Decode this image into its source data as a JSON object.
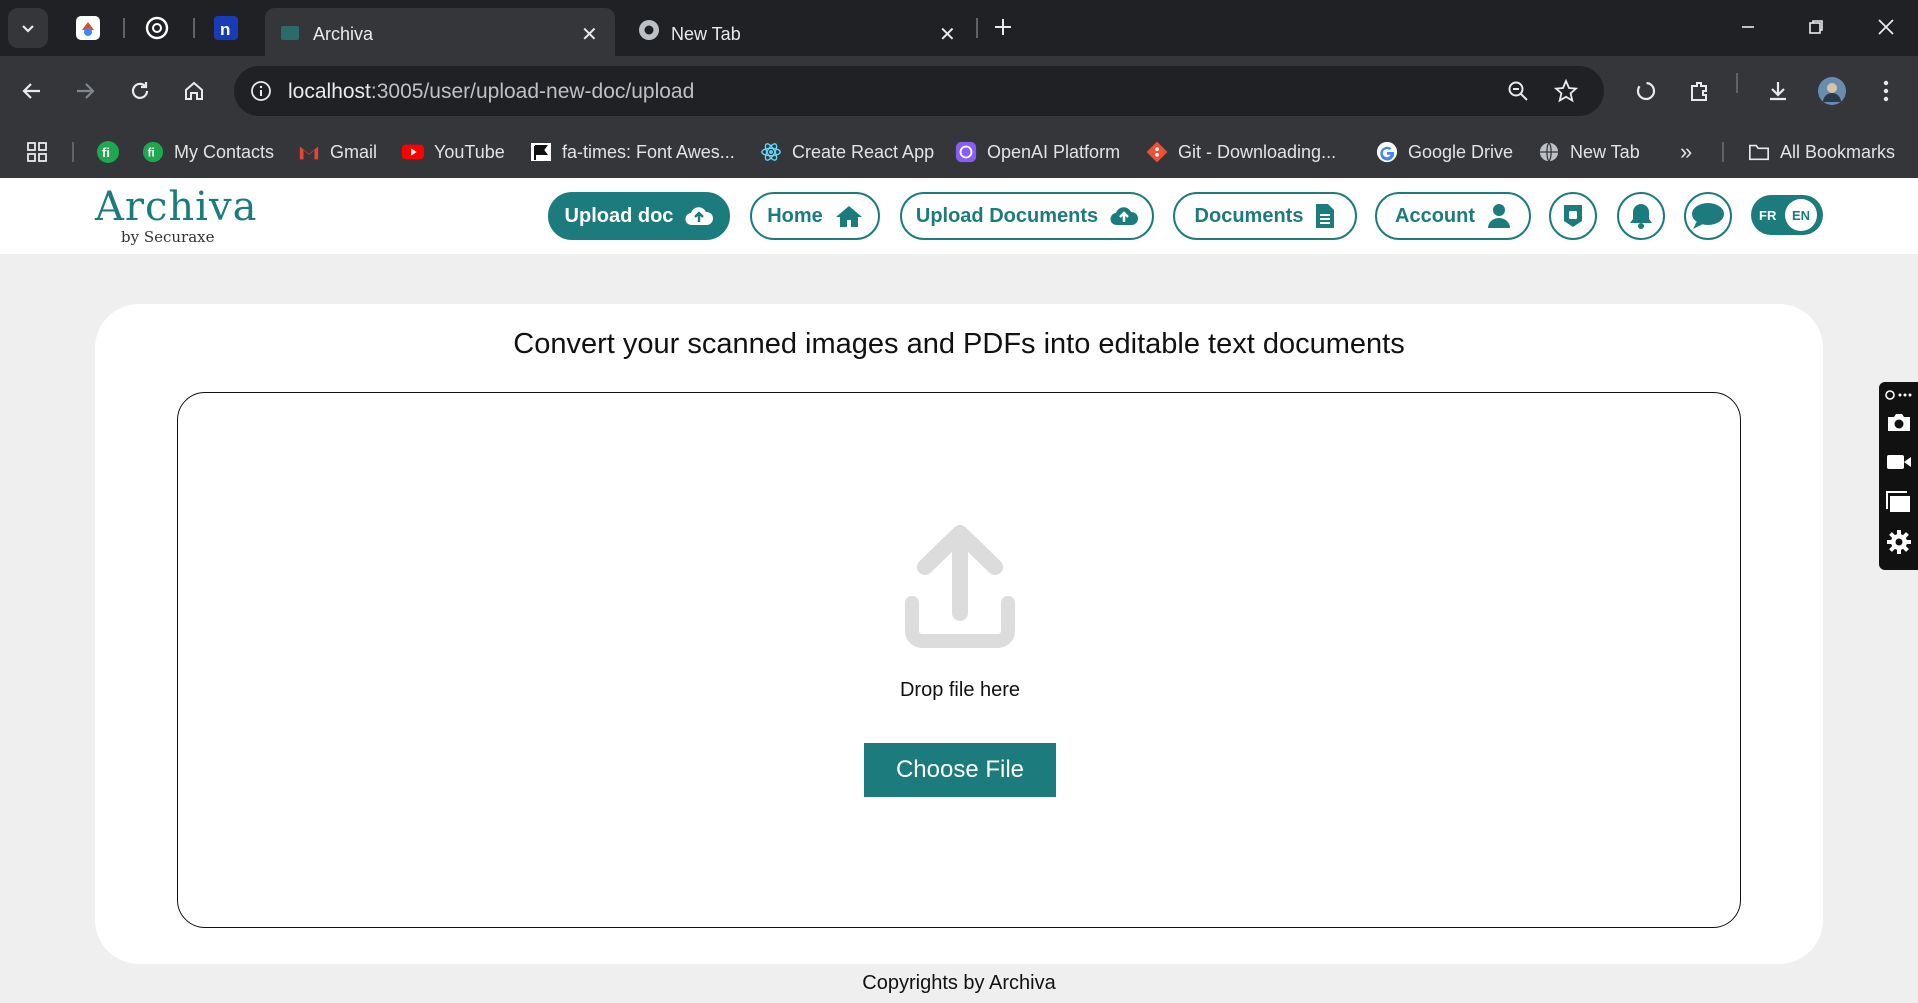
{
  "browser": {
    "tabs": [
      {
        "title": "Archiva",
        "active": true
      },
      {
        "title": "New Tab",
        "active": false
      }
    ],
    "address": {
      "host": "localhost",
      "path": ":3005/user/upload-new-doc/upload"
    },
    "bookmarks": [
      {
        "label": "My Contacts",
        "icon": "contacts-icon"
      },
      {
        "label": "Gmail",
        "icon": "gmail-icon"
      },
      {
        "label": "YouTube",
        "icon": "youtube-icon"
      },
      {
        "label": "fa-times: Font Awes...",
        "icon": "flag-icon"
      },
      {
        "label": "Create React App",
        "icon": "react-icon"
      },
      {
        "label": "OpenAI Platform",
        "icon": "openai-icon"
      },
      {
        "label": "Git - Downloading...",
        "icon": "git-icon"
      },
      {
        "label": "Google Drive",
        "icon": "google-icon"
      },
      {
        "label": "New Tab",
        "icon": "globe-icon"
      }
    ],
    "overflow": "»",
    "all_bookmarks": "All Bookmarks"
  },
  "app": {
    "logo": {
      "name": "Archiva",
      "tagline": "by Securaxe"
    },
    "nav": {
      "upload_doc": "Upload doc",
      "home": "Home",
      "upload_documents": "Upload Documents",
      "documents": "Documents",
      "account": "Account"
    },
    "lang": {
      "fr": "FR",
      "en": "EN"
    },
    "accent": "#1c7c7d"
  },
  "main": {
    "heading": "Convert your scanned images and PDFs into editable text documents",
    "drop_text": "Drop file here",
    "choose_button": "Choose File"
  },
  "footer": {
    "text": "Copyrights by Archiva"
  }
}
